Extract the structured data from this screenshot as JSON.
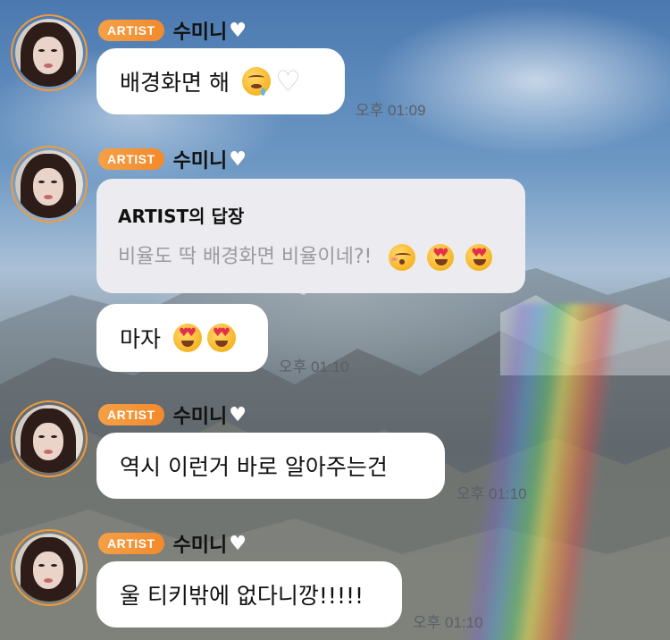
{
  "messages": [
    {
      "badge": "ARTIST",
      "sender": "수미니",
      "text": "배경화면 해",
      "time": "오후 01:09"
    },
    {
      "badge": "ARTIST",
      "sender": "수미니",
      "reply_title": "ARTIST의 답장",
      "reply_quote": "비율도 딱 배경화면 비율이네?!",
      "text": "마자",
      "time": "오후 01:10"
    },
    {
      "badge": "ARTIST",
      "sender": "수미니",
      "text": "역시 이런거 바로 알아주는건",
      "time": "오후 01:10"
    },
    {
      "badge": "ARTIST",
      "sender": "수미니",
      "text": "울 티키밖에 없다니깡!!!!!",
      "time": "오후 01:10"
    }
  ],
  "icons": {
    "sender_heart": "white-heart-icon",
    "emoji_drool": "drooling-face-icon",
    "emoji_heart_eyes": "heart-eyes-face-icon",
    "emoji_kiss": "kissing-face-icon"
  },
  "colors": {
    "badge": "#f28a2c",
    "avatar_ring": "#f29a3a",
    "bubble": "#ffffff",
    "reply_box": "#ececf0"
  }
}
